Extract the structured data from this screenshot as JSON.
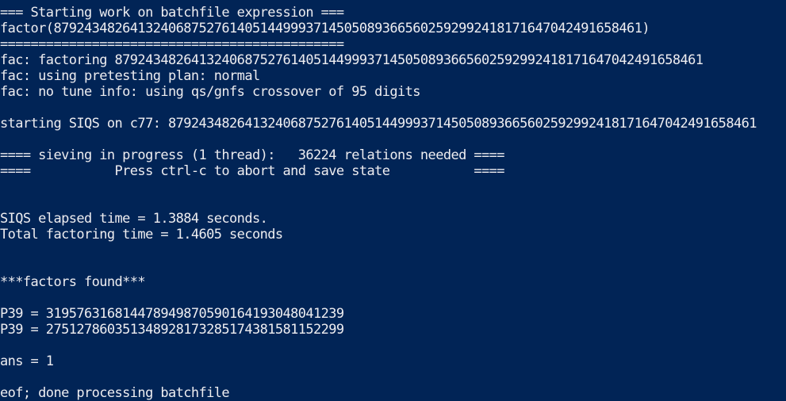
{
  "terminal": {
    "background_color": "#012456",
    "text_color": "#eeedf0",
    "lines": [
      "=== Starting work on batchfile expression ===",
      "factor(87924348264132406875276140514499937145050893665602592992418171647042491658461)",
      "=============================================",
      "fac: factoring 87924348264132406875276140514499937145050893665602592992418171647042491658461",
      "fac: using pretesting plan: normal",
      "fac: no tune info: using qs/gnfs crossover of 95 digits",
      "",
      "starting SIQS on c77: 87924348264132406875276140514499937145050893665602592992418171647042491658461",
      "",
      "==== sieving in progress (1 thread):   36224 relations needed ====",
      "====           Press ctrl-c to abort and save state           ====",
      "",
      "",
      "SIQS elapsed time = 1.3884 seconds.",
      "Total factoring time = 1.4605 seconds",
      "",
      "",
      "***factors found***",
      "",
      "P39 = 319576316814478949870590164193048041239",
      "P39 = 275127860351348928173285174381581152299",
      "",
      "ans = 1",
      "",
      "eof; done processing batchfile"
    ]
  }
}
